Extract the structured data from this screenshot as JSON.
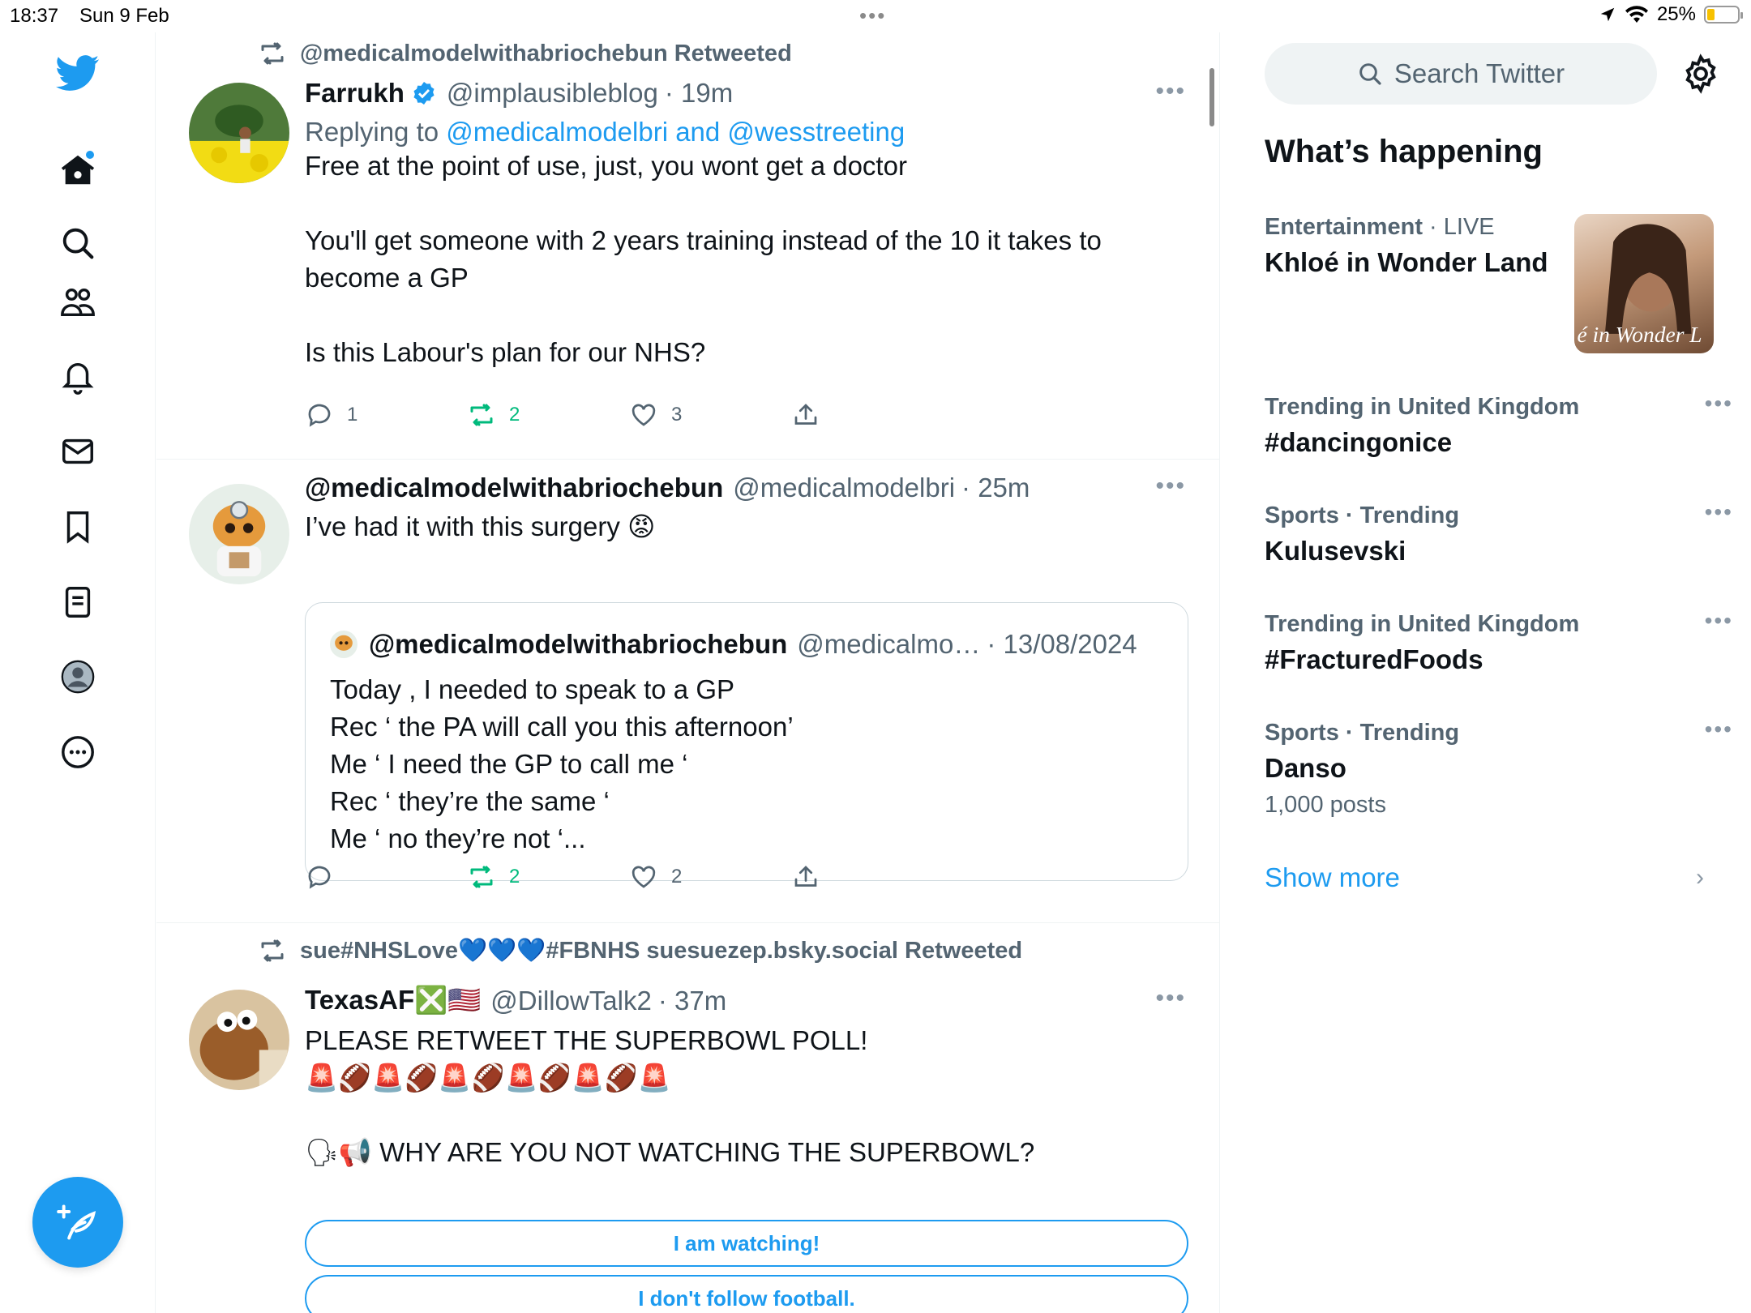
{
  "status_bar": {
    "time": "18:37",
    "date": "Sun 9 Feb",
    "battery": "25%",
    "battery_level": 0.25
  },
  "tweets": [
    {
      "retweeted_by": "@medicalmodelwithabriochebun Retweeted",
      "name": "Farrukh",
      "handle": "@implausibleblog",
      "time": "· 19m",
      "replying_prefix": "Replying to ",
      "replying_users": "@medicalmodelbri and @wesstreeting",
      "text": "Free at the point of use, just, you wont get a doctor\n\nYou'll get someone with 2 years training instead of the 10 it takes to become a GP\n\nIs this Labour's plan for our NHS?",
      "replies": "1",
      "retweets": "2",
      "likes": "3"
    },
    {
      "name": "@medicalmodelwithabriochebun",
      "handle": "@medicalmodelbri",
      "time": "· 25m",
      "text": "I’ve had it with this surgery 😡",
      "retweets": "2",
      "likes": "2",
      "quote": {
        "name": "@medicalmodelwithabriochebun",
        "handle": "@medicalmo…",
        "time": "· 13/08/2024",
        "text": "Today , I needed to speak to a GP\nRec ‘ the PA will call you this afternoon’\nMe ‘ I need the GP to call me ‘\nRec ‘ they’re the same ‘\nMe ‘ no they’re not ‘..."
      }
    },
    {
      "retweeted_by": "sue#NHSLove💙💙💙#FBNHS suesuezep.bsky.social Retweeted",
      "name": "TexasAF❎🇺🇸",
      "handle": "@DillowTalk2",
      "time": "· 37m",
      "text": "PLEASE RETWEET THE SUPERBOWL POLL!\n🚨🏈🚨🏈🚨🏈🚨🏈🚨🏈🚨\n\n🗣📢  WHY ARE YOU  NOT WATCHING THE SUPERBOWL?",
      "poll_options": [
        "I am watching!",
        "I don't follow football."
      ]
    }
  ],
  "sidebar": {
    "search_placeholder": "Search Twitter",
    "heading": "What’s happening",
    "featured": {
      "category": "Entertainment",
      "live": " · LIVE",
      "title": "Khloé in Wonder Land",
      "image_caption": "é in Wonder L"
    },
    "trends": [
      {
        "meta": "Trending in United Kingdom",
        "title": "#dancingonice"
      },
      {
        "meta": "Sports · Trending",
        "title": "Kulusevski"
      },
      {
        "meta": "Trending in United Kingdom",
        "title": "#FracturedFoods"
      },
      {
        "meta": "Sports · Trending",
        "title": "Danso",
        "count": "1,000 posts"
      }
    ],
    "show_more": "Show more"
  },
  "colors": {
    "accent": "#1d9bf0",
    "retweet_green": "#00ba7c",
    "secondary_text": "#536471",
    "border": "#eff3f4"
  }
}
